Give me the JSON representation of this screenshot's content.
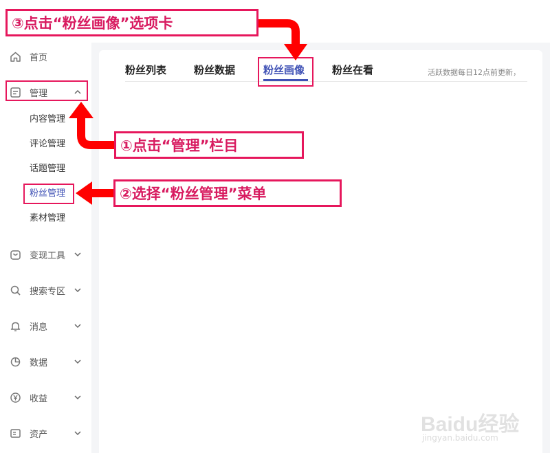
{
  "sidebar": {
    "items": [
      {
        "label": "首页",
        "icon": "home-icon"
      },
      {
        "label": "管理",
        "icon": "document-icon"
      },
      {
        "label": "变现工具",
        "icon": "bag-icon"
      },
      {
        "label": "搜索专区",
        "icon": "search-icon"
      },
      {
        "label": "消息",
        "icon": "bell-icon"
      },
      {
        "label": "数据",
        "icon": "pie-chart-icon"
      },
      {
        "label": "收益",
        "icon": "yen-icon"
      },
      {
        "label": "资产",
        "icon": "wallet-icon"
      }
    ],
    "sub_items": [
      "内容管理",
      "评论管理",
      "话题管理",
      "粉丝管理",
      "素材管理"
    ],
    "active_sub_item": "粉丝管理"
  },
  "main": {
    "tabs": [
      {
        "label": "粉丝列表"
      },
      {
        "label": "粉丝数据"
      },
      {
        "label": "粉丝画像"
      },
      {
        "label": "粉丝在看"
      }
    ],
    "active_tab": "粉丝画像",
    "update_note": "活跃数据每日12点前更新，"
  },
  "annotations": {
    "step1": "①点击“管理”栏目",
    "step2": "②选择“粉丝管理”菜单",
    "step3": "③点击“粉丝画像”选项卡"
  },
  "watermark": {
    "logo": "Baidu经验",
    "url": "jingyan.baidu.com"
  },
  "colors": {
    "annotation": "#e6175c",
    "arrow": "#ff0000",
    "active": "#3f51b5"
  }
}
